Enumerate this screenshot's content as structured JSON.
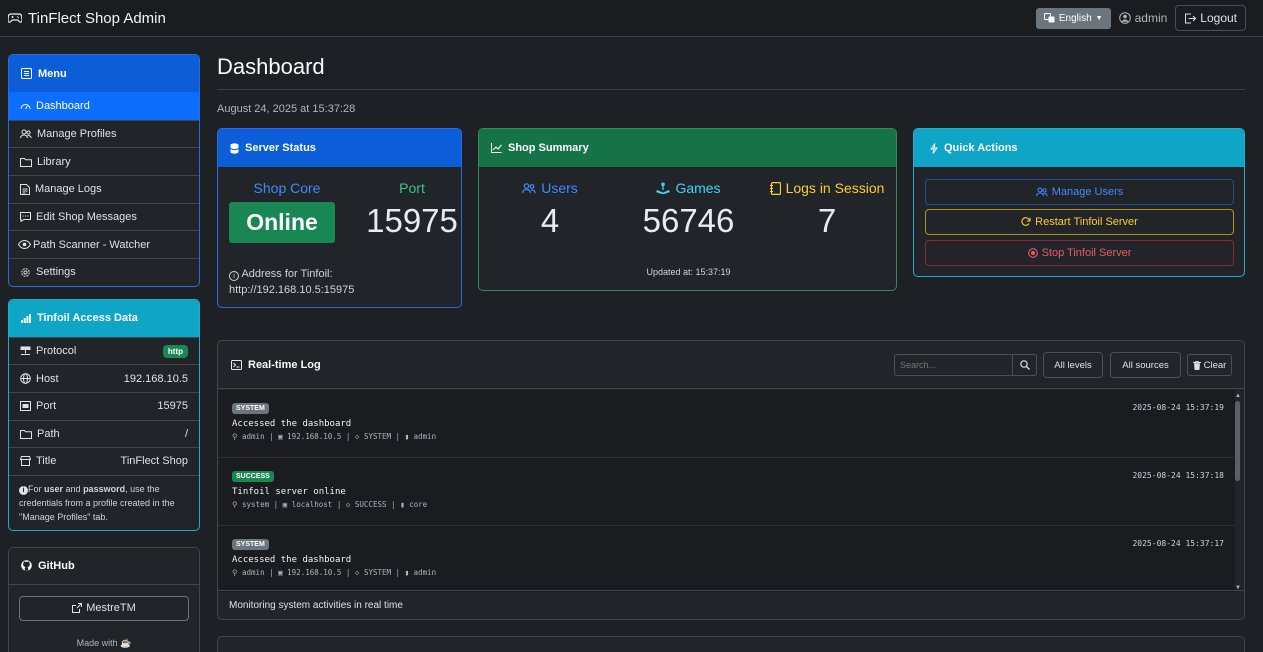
{
  "app": {
    "title": "TinFlect Shop Admin"
  },
  "topbar": {
    "language": "English",
    "user": "admin",
    "logout": "Logout"
  },
  "menu": {
    "title": "Menu",
    "items": [
      {
        "label": "Dashboard",
        "icon": "speedometer-icon"
      },
      {
        "label": "Manage Profiles",
        "icon": "people-icon"
      },
      {
        "label": "Library",
        "icon": "folder-icon"
      },
      {
        "label": "Manage Logs",
        "icon": "file-text-icon"
      },
      {
        "label": "Edit Shop Messages",
        "icon": "chat-icon"
      },
      {
        "label": "Path Scanner - Watcher",
        "icon": "eye-icon"
      },
      {
        "label": "Settings",
        "icon": "gear-icon"
      }
    ]
  },
  "access": {
    "title": "Tinfoil Access Data",
    "rows": [
      {
        "label": "Protocol",
        "value": "http"
      },
      {
        "label": "Host",
        "value": "192.168.10.5"
      },
      {
        "label": "Port",
        "value": "15975"
      },
      {
        "label": "Path",
        "value": "/"
      },
      {
        "label": "Title",
        "value": "TinFlect Shop"
      }
    ],
    "note_prefix": "For ",
    "note_user": "user",
    "note_and": " and ",
    "note_password": "password",
    "note_rest": ", use the credentials from a profile created in the \"Manage Profiles\" tab."
  },
  "github": {
    "title": "GitHub",
    "link": "MestreTM",
    "made_with": "Made with ☕"
  },
  "page": {
    "title": "Dashboard",
    "date": "August 24, 2025 at 15:37:28"
  },
  "server_status": {
    "title": "Server Status",
    "core_label": "Shop Core",
    "core_state": "Online",
    "port_label": "Port",
    "port_value": "15975",
    "address_label": "Address for Tinfoil:",
    "address_value": "http://192.168.10.5:15975"
  },
  "shop_summary": {
    "title": "Shop Summary",
    "users_label": "Users",
    "users_value": "4",
    "games_label": "Games",
    "games_value": "56746",
    "logs_label": "Logs in Session",
    "logs_value": "7",
    "updated": "Updated at: 15:37:19"
  },
  "quick_actions": {
    "title": "Quick Actions",
    "manage_users": "Manage Users",
    "restart": "Restart Tinfoil Server",
    "stop": "Stop Tinfoil Server"
  },
  "log": {
    "title": "Real-time Log",
    "search_placeholder": "Search...",
    "levels": "All levels",
    "sources": "All sources",
    "clear": "Clear",
    "footer": "Monitoring system activities in real time",
    "entries": [
      {
        "level": "SYSTEM",
        "time": "2025-08-24 15:37:19",
        "message": "Accessed the dashboard",
        "user": "admin",
        "ip": "192.168.10.5",
        "tag": "SYSTEM",
        "source": "admin"
      },
      {
        "level": "SUCCESS",
        "time": "2025-08-24 15:37:18",
        "message": "Tinfoil server online",
        "user": "system",
        "ip": "localhost",
        "tag": "SUCCESS",
        "source": "core"
      },
      {
        "level": "SYSTEM",
        "time": "2025-08-24 15:37:17",
        "message": "Accessed the dashboard",
        "user": "admin",
        "ip": "192.168.10.5",
        "tag": "SYSTEM",
        "source": "admin"
      }
    ]
  },
  "colors": {
    "primary": "#0d6efd",
    "success": "#198754",
    "info": "#0dcaf0",
    "warning": "#ffc107",
    "danger": "#dc3545"
  }
}
